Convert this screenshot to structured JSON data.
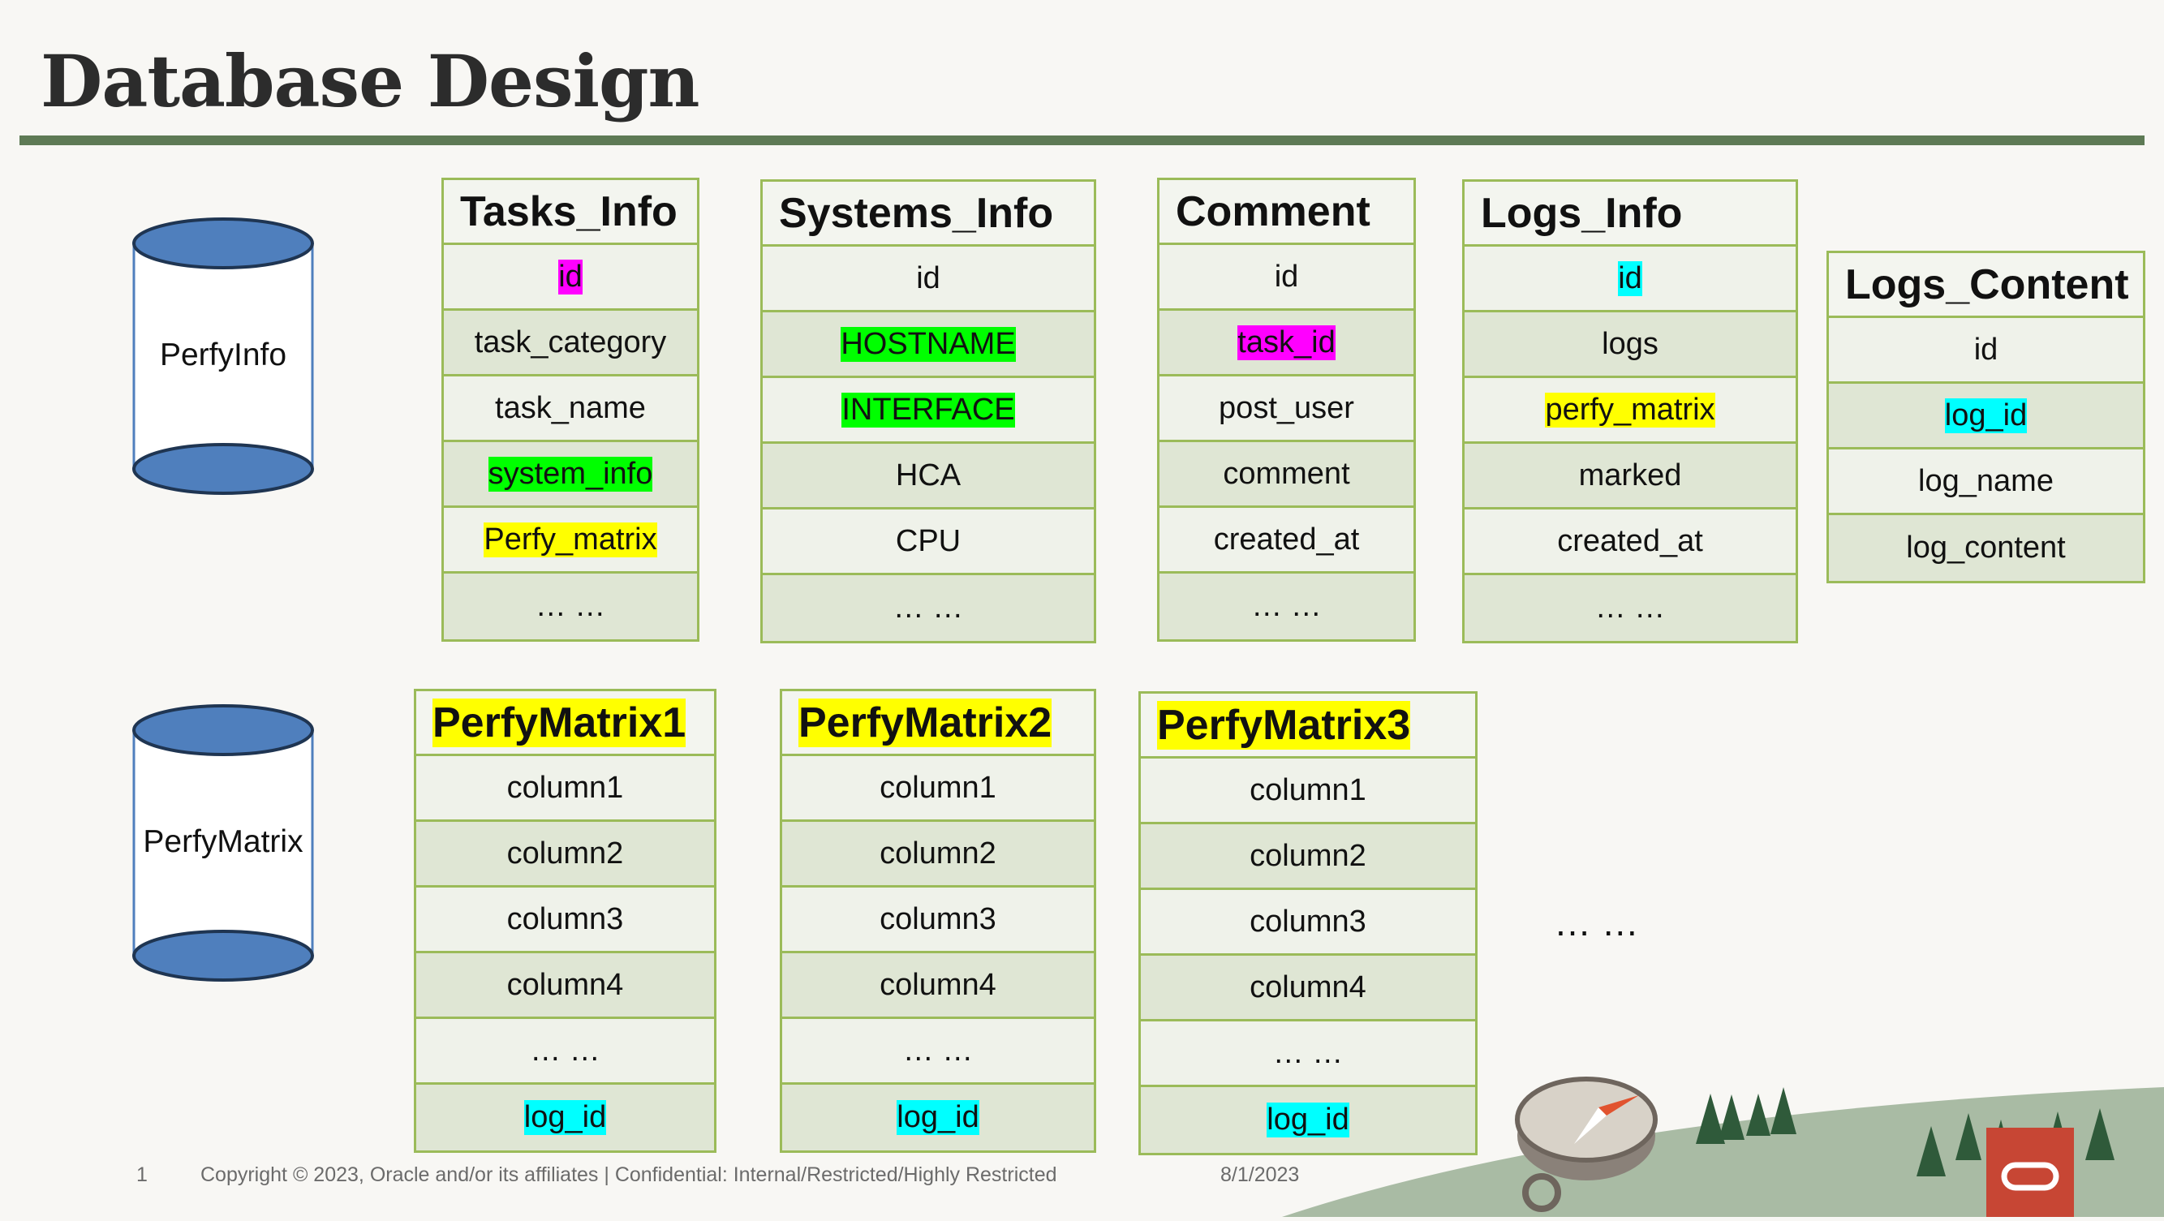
{
  "title": "Database Design",
  "databases": [
    {
      "label": "PerfyInfo"
    },
    {
      "label": "PerfyMatrix"
    }
  ],
  "tables": [
    {
      "name": "Tasks_Info",
      "name_highlight": "none",
      "fields": [
        {
          "text": "id",
          "highlight": "magenta"
        },
        {
          "text": "task_category",
          "highlight": "none"
        },
        {
          "text": "task_name",
          "highlight": "none"
        },
        {
          "text": "system_info",
          "highlight": "green"
        },
        {
          "text": "Perfy_matrix",
          "highlight": "yellow"
        },
        {
          "text": "… …",
          "highlight": "none"
        }
      ]
    },
    {
      "name": "Systems_Info",
      "name_highlight": "none",
      "fields": [
        {
          "text": "id",
          "highlight": "none"
        },
        {
          "text": "HOSTNAME",
          "highlight": "green"
        },
        {
          "text": "INTERFACE",
          "highlight": "green"
        },
        {
          "text": "HCA",
          "highlight": "none"
        },
        {
          "text": "CPU",
          "highlight": "none"
        },
        {
          "text": "… …",
          "highlight": "none"
        }
      ]
    },
    {
      "name": "Comment",
      "name_highlight": "none",
      "fields": [
        {
          "text": "id",
          "highlight": "none"
        },
        {
          "text": "task_id",
          "highlight": "magenta"
        },
        {
          "text": "post_user",
          "highlight": "none"
        },
        {
          "text": "comment",
          "highlight": "none"
        },
        {
          "text": "created_at",
          "highlight": "none"
        },
        {
          "text": "… …",
          "highlight": "none"
        }
      ]
    },
    {
      "name": "Logs_Info",
      "name_highlight": "none",
      "fields": [
        {
          "text": "id",
          "highlight": "cyan"
        },
        {
          "text": "logs",
          "highlight": "none"
        },
        {
          "text": "perfy_matrix",
          "highlight": "yellow"
        },
        {
          "text": "marked",
          "highlight": "none"
        },
        {
          "text": "created_at",
          "highlight": "none"
        },
        {
          "text": "… …",
          "highlight": "none"
        }
      ]
    },
    {
      "name": "Logs_Content",
      "name_highlight": "none",
      "fields": [
        {
          "text": "id",
          "highlight": "none"
        },
        {
          "text": "log_id",
          "highlight": "cyan"
        },
        {
          "text": "log_name",
          "highlight": "none"
        },
        {
          "text": "log_content",
          "highlight": "none"
        }
      ]
    },
    {
      "name": "PerfyMatrix1",
      "name_highlight": "yellow",
      "fields": [
        {
          "text": "column1",
          "highlight": "none"
        },
        {
          "text": "column2",
          "highlight": "none"
        },
        {
          "text": "column3",
          "highlight": "none"
        },
        {
          "text": "column4",
          "highlight": "none"
        },
        {
          "text": "… …",
          "highlight": "none"
        },
        {
          "text": "log_id",
          "highlight": "cyan"
        }
      ]
    },
    {
      "name": "PerfyMatrix2",
      "name_highlight": "yellow",
      "fields": [
        {
          "text": "column1",
          "highlight": "none"
        },
        {
          "text": "column2",
          "highlight": "none"
        },
        {
          "text": "column3",
          "highlight": "none"
        },
        {
          "text": "column4",
          "highlight": "none"
        },
        {
          "text": "… …",
          "highlight": "none"
        },
        {
          "text": "log_id",
          "highlight": "cyan"
        }
      ]
    },
    {
      "name": "PerfyMatrix3",
      "name_highlight": "yellow",
      "fields": [
        {
          "text": "column1",
          "highlight": "none"
        },
        {
          "text": "column2",
          "highlight": "none"
        },
        {
          "text": "column3",
          "highlight": "none"
        },
        {
          "text": "column4",
          "highlight": "none"
        },
        {
          "text": "… …",
          "highlight": "none"
        },
        {
          "text": "log_id",
          "highlight": "cyan"
        }
      ]
    }
  ],
  "more_tables": "… …",
  "footer": {
    "page_number": "1",
    "copyright": "Copyright © 2023, Oracle and/or its affiliates  |  Confidential: Internal/Restricted/Highly Restricted",
    "date": "8/1/2023"
  },
  "colors": {
    "title_rule": "#5e7a55",
    "table_border": "#9bbb59",
    "cylinder_fill": "#4f7fbd",
    "oracle_red": "#c74634"
  },
  "icons": [
    "compass-icon",
    "oracle-logo-icon",
    "tree-icon"
  ]
}
